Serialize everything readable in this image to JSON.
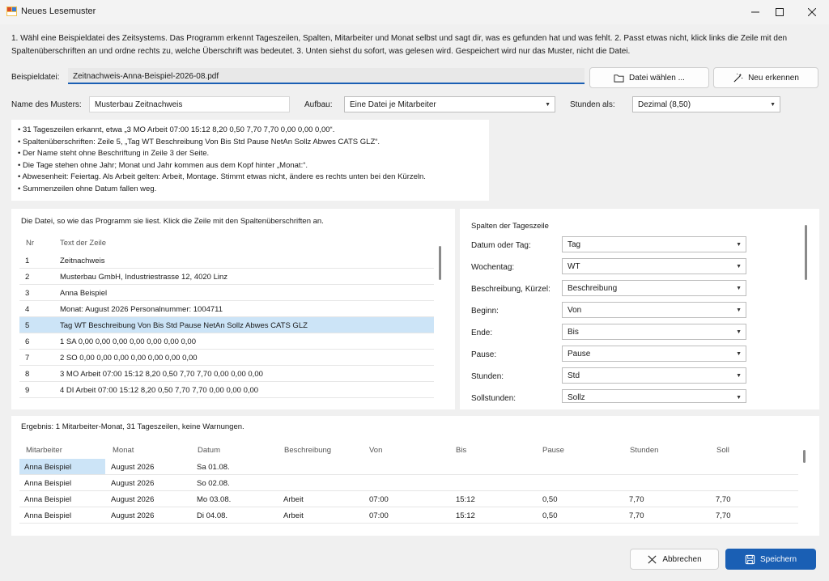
{
  "window": {
    "title": "Neues Lesemuster"
  },
  "instructions": "1. Wähl eine Beispieldatei des Zeitsystems. Das Programm erkennt Tageszeilen, Spalten, Mitarbeiter und Monat selbst und sagt dir, was es gefunden hat und was fehlt. 2. Passt etwas nicht, klick links die Zeile mit den Spaltenüberschriften an und ordne rechts zu, welche Überschrift was bedeutet. 3. Unten siehst du sofort, was gelesen wird. Gespeichert wird nur das Muster, nicht die Datei.",
  "file": {
    "label": "Beispieldatei:",
    "value": "Zeitnachweis-Anna-Beispiel-2026-08.pdf",
    "choose_button": "Datei wählen ...",
    "detect_button": "Neu erkennen"
  },
  "settings": {
    "name_label": "Name des Musters:",
    "name_value": "Musterbau Zeitnachweis",
    "layout_label": "Aufbau:",
    "layout_value": "Eine Datei je Mitarbeiter",
    "hours_label": "Stunden als:",
    "hours_value": "Dezimal (8,50)"
  },
  "info": [
    "• 31 Tageszeilen erkannt, etwa „3 MO Arbeit 07:00 15:12 8,20 0,50 7,70 7,70 0,00 0,00 0,00“.",
    "• Spaltenüberschriften: Zeile 5, „Tag WT Beschreibung Von Bis Std Pause NetAn Sollz Abwes CATS GLZ“.",
    "• Der Name steht ohne Beschriftung in Zeile 3 der Seite.",
    "• Die Tage stehen ohne Jahr; Monat und Jahr kommen aus dem Kopf hinter „Monat:“.",
    "• Abwesenheit: Feiertag. Als Arbeit gelten: Arbeit, Montage. Stimmt etwas nicht, ändere es rechts unten bei den Kürzeln.",
    "• Summenzeilen ohne Datum fallen weg."
  ],
  "file_panel": {
    "title": "Die Datei, so wie das Programm sie liest. Klick die Zeile mit den Spaltenüberschriften an.",
    "col_nr": "Nr",
    "col_text": "Text der Zeile",
    "rows": [
      {
        "nr": "1",
        "text": "Zeitnachweis"
      },
      {
        "nr": "2",
        "text": "Musterbau GmbH, Industriestrasse 12, 4020 Linz"
      },
      {
        "nr": "3",
        "text": "Anna Beispiel"
      },
      {
        "nr": "4",
        "text": "Monat: August 2026 Personalnummer: 1004711"
      },
      {
        "nr": "5",
        "text": "Tag WT Beschreibung Von Bis Std Pause NetAn Sollz Abwes CATS GLZ"
      },
      {
        "nr": "6",
        "text": "1 SA 0,00 0,00 0,00 0,00 0,00 0,00 0,00"
      },
      {
        "nr": "7",
        "text": "2 SO 0,00 0,00 0,00 0,00 0,00 0,00 0,00"
      },
      {
        "nr": "8",
        "text": "3 MO Arbeit 07:00 15:12 8,20 0,50 7,70 7,70 0,00 0,00 0,00"
      },
      {
        "nr": "9",
        "text": "4 DI Arbeit 07:00 15:12 8,20 0,50 7,70 7,70 0,00 0,00 0,00"
      }
    ]
  },
  "mapping": {
    "title": "Spalten der Tageszeile",
    "rows": [
      {
        "label": "Datum oder Tag:",
        "value": "Tag"
      },
      {
        "label": "Wochentag:",
        "value": "WT"
      },
      {
        "label": "Beschreibung, Kürzel:",
        "value": "Beschreibung"
      },
      {
        "label": "Beginn:",
        "value": "Von"
      },
      {
        "label": "Ende:",
        "value": "Bis"
      },
      {
        "label": "Pause:",
        "value": "Pause"
      },
      {
        "label": "Stunden:",
        "value": "Std"
      },
      {
        "label": "Sollstunden:",
        "value": "Sollz"
      }
    ]
  },
  "result": {
    "title": "Ergebnis: 1 Mitarbeiter-Monat, 31 Tageszeilen, keine Warnungen.",
    "headers": [
      "Mitarbeiter",
      "Monat",
      "Datum",
      "Beschreibung",
      "Von",
      "Bis",
      "Pause",
      "Stunden",
      "Soll"
    ],
    "rows": [
      [
        "Anna Beispiel",
        "August 2026",
        "Sa 01.08.",
        "",
        "",
        "",
        "",
        "",
        ""
      ],
      [
        "Anna Beispiel",
        "August 2026",
        "So 02.08.",
        "",
        "",
        "",
        "",
        "",
        ""
      ],
      [
        "Anna Beispiel",
        "August 2026",
        "Mo 03.08.",
        "Arbeit",
        "07:00",
        "15:12",
        "0,50",
        "7,70",
        "7,70"
      ],
      [
        "Anna Beispiel",
        "August 2026",
        "Di 04.08.",
        "Arbeit",
        "07:00",
        "15:12",
        "0,50",
        "7,70",
        "7,70"
      ]
    ]
  },
  "footer": {
    "cancel": "Abbrechen",
    "save": "Speichern"
  },
  "colors": {
    "accent": "#1a5fb4",
    "selection": "#cce4f7"
  }
}
